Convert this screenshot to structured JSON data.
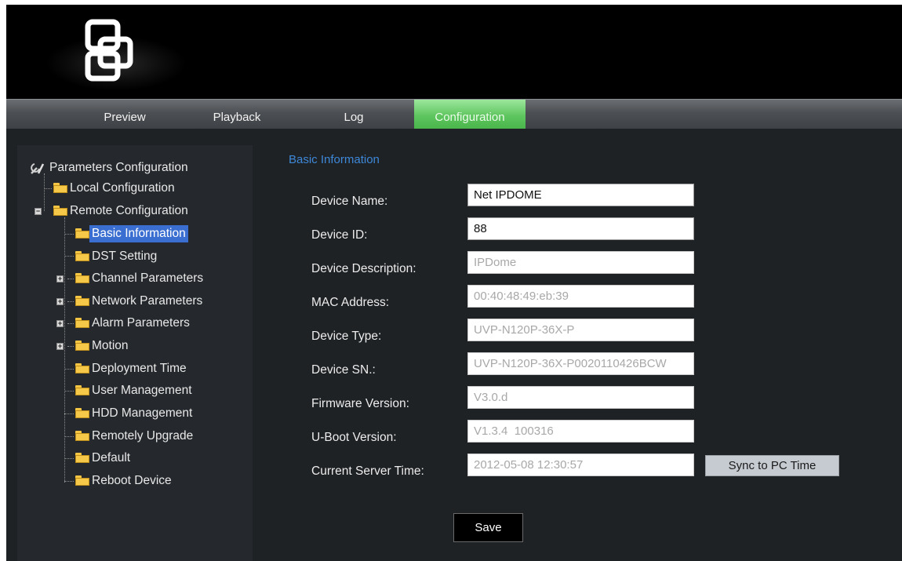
{
  "nav": {
    "tabs": [
      {
        "label": "Preview"
      },
      {
        "label": "Playback"
      },
      {
        "label": "Log"
      },
      {
        "label": "Configuration"
      }
    ],
    "active_tab": "Configuration"
  },
  "sidebar": {
    "root_label": "Parameters Configuration",
    "local_label": "Local Configuration",
    "remote_label": "Remote Configuration",
    "items": [
      {
        "label": "Basic Information"
      },
      {
        "label": "DST Setting"
      },
      {
        "label": "Channel Parameters"
      },
      {
        "label": "Network Parameters"
      },
      {
        "label": "Alarm Parameters"
      },
      {
        "label": "Motion"
      },
      {
        "label": "Deployment Time"
      },
      {
        "label": "User Management"
      },
      {
        "label": "HDD Management"
      },
      {
        "label": "Remotely Upgrade"
      },
      {
        "label": "Default"
      },
      {
        "label": "Reboot Device"
      }
    ],
    "selected": "Basic Information"
  },
  "main": {
    "section_title": "Basic Information",
    "fields": [
      {
        "label": "Device Name:",
        "value": "Net IPDOME"
      },
      {
        "label": "Device ID:",
        "value": "88"
      },
      {
        "label": "Device Description:",
        "value": "IPDome"
      },
      {
        "label": "MAC Address:",
        "value": "00:40:48:49:eb:39"
      },
      {
        "label": "Device Type:",
        "value": "UVP-N120P-36X-P"
      },
      {
        "label": "Device SN.:",
        "value": "UVP-N120P-36X-P0020110426BCW"
      },
      {
        "label": "Firmware Version:",
        "value": "V3.0.d"
      },
      {
        "label": "U-Boot Version:",
        "value": "V1.3.4  100316"
      },
      {
        "label": "Current Server Time:",
        "value": "2012-05-08 12:30:57"
      }
    ],
    "sync_button_label": "Sync to PC Time",
    "save_button_label": "Save"
  },
  "colors": {
    "accent_tab": "#5fc65f",
    "selection": "#3a6fd1",
    "section_title": "#3d88d8",
    "background": "#1f2225"
  },
  "icons": {
    "logo": "interlocking-squares-logo-icon",
    "root": "tools-icon",
    "folder": "folder-icon",
    "expand": "plus-box-icon",
    "collapse": "minus-box-icon"
  }
}
